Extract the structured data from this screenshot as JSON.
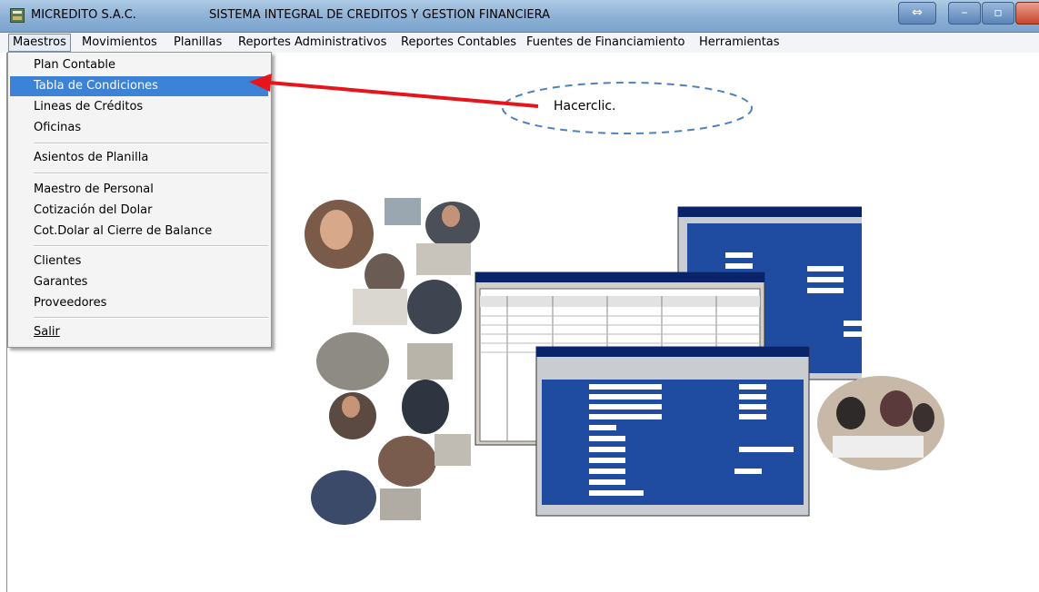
{
  "window": {
    "app_name": "MICREDITO S.A.C.",
    "title": "SISTEMA INTEGRAL DE CREDITOS Y GESTION FINANCIERA"
  },
  "menubar": {
    "items": [
      {
        "label": "Maestros"
      },
      {
        "label": "Movimientos"
      },
      {
        "label": "Planillas"
      },
      {
        "label": "Reportes Administrativos"
      },
      {
        "label": "Reportes Contables"
      },
      {
        "label": "Fuentes de Financiamiento"
      },
      {
        "label": "Herramientas"
      }
    ]
  },
  "dropdown": {
    "items": [
      {
        "label": "Plan Contable"
      },
      {
        "label": "Tabla de Condiciones"
      },
      {
        "label": "Lineas de Créditos"
      },
      {
        "label": "Oficinas"
      },
      {
        "label": "Asientos de Planilla"
      },
      {
        "label": "Maestro de Personal"
      },
      {
        "label": "Cotización del Dolar"
      },
      {
        "label": "Cot.Dolar al Cierre de Balance"
      },
      {
        "label": "Clientes"
      },
      {
        "label": "Garantes"
      },
      {
        "label": "Proveedores"
      },
      {
        "label": "Salir"
      }
    ]
  },
  "annotation": {
    "text": "Hacerclic.",
    "arrow_color": "#e8141c",
    "ellipse_color": "#4f81bd"
  },
  "colors": {
    "selection": "#3c82d6",
    "titlebar": "#8fb2d6"
  }
}
